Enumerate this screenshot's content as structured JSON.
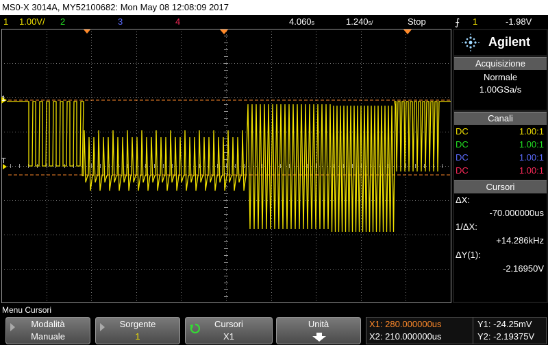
{
  "title": "MS0-X 3014A, MY52100682: Mon May 08 12:08:09 2017",
  "status": {
    "ch1_num": "1",
    "ch1_scale": "1.00V/",
    "ch2_num": "2",
    "ch3_num": "3",
    "ch4_num": "4",
    "time_delay": "4.060",
    "delay_unit": "s",
    "time_scale": "1.240",
    "scale_unit": "s/",
    "run_state": "Stop",
    "trig_icon": "trigger-edge-icon",
    "trig_channel": "1",
    "trig_level": "-1.98V"
  },
  "panel": {
    "brand": "Agilent",
    "acq_header": "Acquisizione",
    "acq_mode": "Normale",
    "acq_rate": "1.00GSa/s",
    "channels_header": "Canali",
    "channels": [
      {
        "coupling": "DC",
        "value": "1.00:1",
        "color": "#f0e000"
      },
      {
        "coupling": "DC",
        "value": "1.00:1",
        "color": "#22e022"
      },
      {
        "coupling": "DC",
        "value": "1.00:1",
        "color": "#5c6cff"
      },
      {
        "coupling": "DC",
        "value": "1.00:1",
        "color": "#ff2a5a"
      }
    ],
    "cursors_header": "Cursori",
    "dx_label": "ΔX:",
    "dx_value": "-70.000000us",
    "inv_dx_label": "1/ΔX:",
    "inv_dx_value": "+14.286kHz",
    "dy_label": "ΔY(1):",
    "dy_value": "-2.16950V"
  },
  "markers": {
    "ch1_label": "1",
    "trig_label": "T"
  },
  "menu_title": "Menu Cursori",
  "softkeys": [
    {
      "l1": "Modalità",
      "l2": "Manuale"
    },
    {
      "l1": "Sorgente",
      "l2": "1"
    },
    {
      "l1": "Cursori",
      "l2": "X1"
    },
    {
      "l1": "Unità",
      "l2": ""
    }
  ],
  "cursor_readout": {
    "x1": "X1: 280.000000us",
    "x2": "X2: 210.000000us",
    "y1": "Y1: -24.25mV",
    "y2": "Y2: -2.19375V"
  },
  "colors": {
    "ch1": "#f0e000",
    "cursor": "#ff8a2a",
    "grid": "#7a7a7a"
  }
}
